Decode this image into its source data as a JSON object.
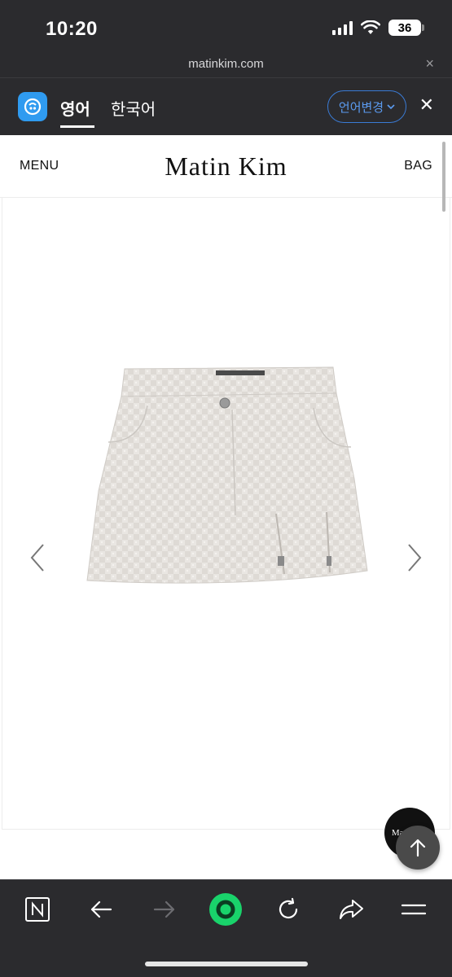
{
  "status_bar": {
    "time": "10:20",
    "battery": "36"
  },
  "url_bar": {
    "url": "matinkim.com",
    "close": "×"
  },
  "translate_bar": {
    "source_lang": "영어",
    "target_lang": "한국어",
    "change_lang_button": "언어변경",
    "close": "✕"
  },
  "site": {
    "menu_label": "MENU",
    "brand": "Matin Kim",
    "bag_label": "BAG",
    "mini_badge": "Matin"
  },
  "colors": {
    "browser_bg": "#2b2b2e",
    "accent_blue": "#2f9bf0",
    "accent_green": "#19d36b"
  },
  "toolbar": {
    "buttons": [
      "naver-home-icon",
      "back-arrow-icon",
      "forward-arrow-icon",
      "green-dot-icon",
      "reload-icon",
      "share-icon",
      "hamburger-menu-icon"
    ]
  }
}
